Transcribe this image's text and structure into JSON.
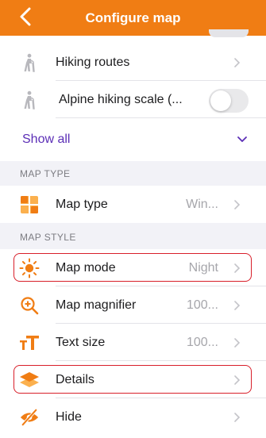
{
  "header": {
    "title": "Configure map"
  },
  "routes": {
    "items": [
      {
        "label": "Hiking routes",
        "icon": "hiker-icon"
      },
      {
        "label": "Alpine hiking scale (...",
        "icon": "hiker-icon",
        "toggle": false
      }
    ],
    "show_all_label": "Show all"
  },
  "map_type": {
    "section_title": "MAP TYPE",
    "row": {
      "label": "Map type",
      "value": "Win...",
      "icon": "map-type-icon"
    }
  },
  "map_style": {
    "section_title": "MAP STYLE",
    "rows": [
      {
        "label": "Map mode",
        "value": "Night",
        "icon": "sun-icon",
        "highlighted": true
      },
      {
        "label": "Map magnifier",
        "value": "100...",
        "icon": "magnifier-icon"
      },
      {
        "label": "Text size",
        "value": "100...",
        "icon": "text-size-icon"
      },
      {
        "label": "Details",
        "value": "",
        "icon": "layers-icon",
        "highlighted": true
      },
      {
        "label": "Hide",
        "value": "",
        "icon": "eye-off-icon"
      }
    ]
  },
  "colors": {
    "accent": "#f07d14",
    "link": "#5b2eb6",
    "highlight_border": "#d81f2a"
  }
}
